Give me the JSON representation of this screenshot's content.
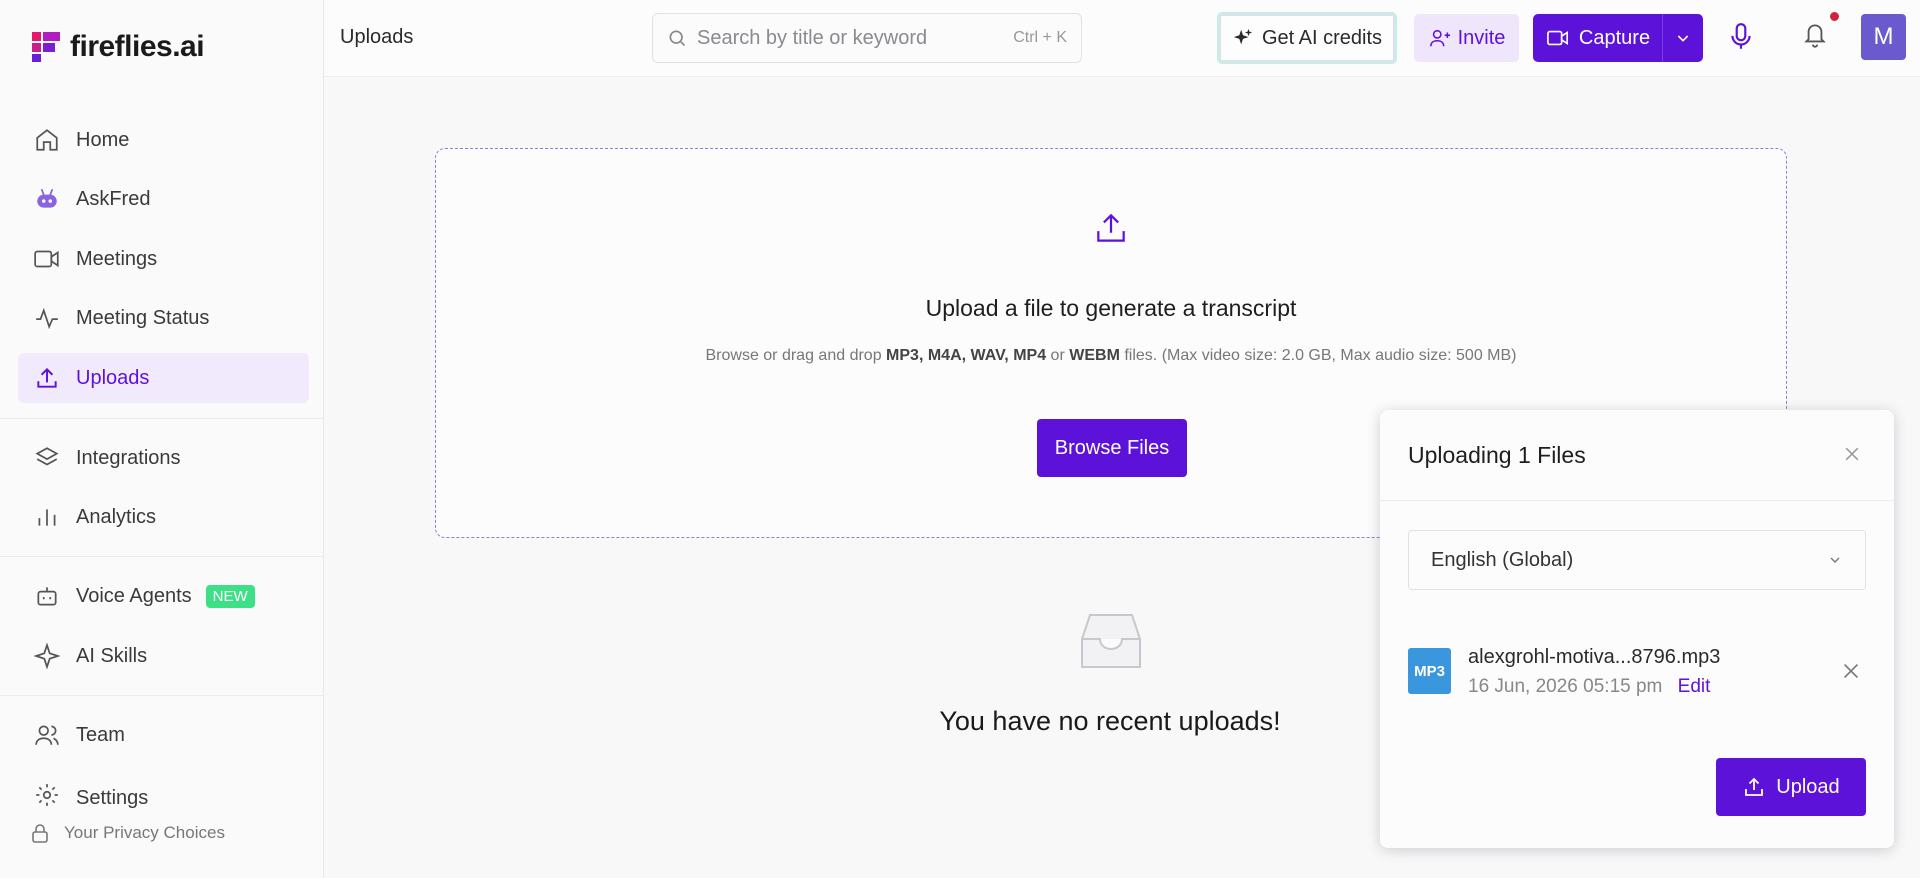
{
  "sidebar": {
    "brand": "fireflies.ai",
    "items": [
      {
        "label": "Home",
        "icon": "home-icon"
      },
      {
        "label": "AskFred",
        "icon": "robot-icon"
      },
      {
        "label": "Meetings",
        "icon": "video-icon"
      },
      {
        "label": "Meeting Status",
        "icon": "activity-icon"
      },
      {
        "label": "Uploads",
        "icon": "upload-icon",
        "active": true
      },
      {
        "label": "Integrations",
        "icon": "layers-icon"
      },
      {
        "label": "Analytics",
        "icon": "bar-chart-icon"
      },
      {
        "label": "Voice Agents",
        "icon": "bot-icon",
        "badge": "NEW"
      },
      {
        "label": "AI Skills",
        "icon": "sparkle-icon"
      },
      {
        "label": "Team",
        "icon": "users-icon"
      },
      {
        "label": "Settings",
        "icon": "gear-icon"
      }
    ],
    "privacy": "Your Privacy Choices"
  },
  "topbar": {
    "title": "Uploads",
    "search_placeholder": "Search by title or keyword",
    "search_shortcut": "Ctrl + K",
    "credits_label": "Get AI credits",
    "invite_label": "Invite",
    "capture_label": "Capture",
    "avatar_initial": "M"
  },
  "dropzone": {
    "title": "Upload a file to generate a transcript",
    "sub_prefix": "Browse or drag and drop",
    "formats": "MP3, M4A, WAV, MP4",
    "or": "or",
    "format_last": "WEBM",
    "sub_suffix": "files. (Max video size: 2.0 GB, Max audio size: 500 MB)",
    "browse_label": "Browse Files"
  },
  "empty": {
    "text": "You have no recent uploads!"
  },
  "panel": {
    "title": "Uploading 1 Files",
    "language": "English (Global)",
    "file": {
      "type": "MP3",
      "name": "alexgrohl-motiva...8796.mp3",
      "date": "16 Jun, 2026 05:15 pm",
      "edit": "Edit"
    },
    "upload_label": "Upload"
  },
  "colors": {
    "accent": "#5d12d9",
    "badge_new": "#3ee087",
    "mp3": "#3a96dd",
    "notification": "#d3213c"
  }
}
